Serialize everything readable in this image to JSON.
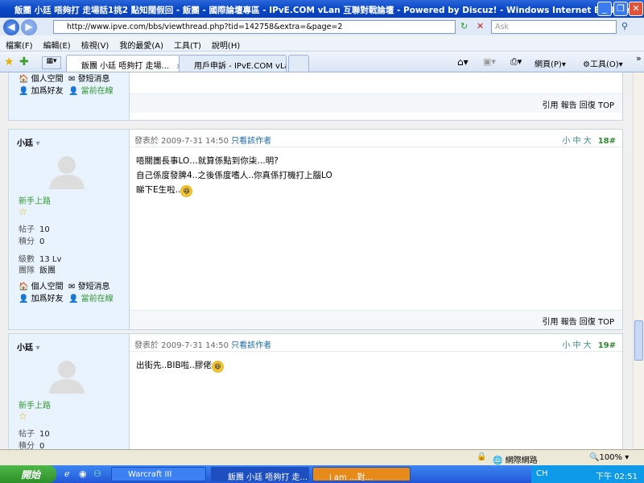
{
  "window": {
    "title": "飯團 小廷 唔夠打 走場話1挑2 點知闊假回 - 飯團 - 國際論壇專區 - IPvE.COM vLan 互聯對戰論壇 - Powered by Discuz! - Windows Internet Explorer"
  },
  "address": {
    "url": "http://www.ipve.com/bbs/viewthread.php?tid=142758&extra=&page=2",
    "search_placeholder": "Ask"
  },
  "menu": [
    "檔案(F)",
    "編輯(E)",
    "檢視(V)",
    "我的最愛(A)",
    "工具(T)",
    "說明(H)"
  ],
  "tabs": [
    {
      "label": "飯團 小廷 唔夠打 走場...",
      "close": "x"
    },
    {
      "label": "用戶申訴 - IPvE.COM vLan ..."
    }
  ],
  "toolbar": {
    "page": "網頁(P)",
    "tools": "工具(O)",
    "more": "»"
  },
  "post_prev": {
    "links": [
      "個人空間",
      "發短消息",
      "加爲好友",
      "當前在線"
    ],
    "actions": "引用 報告 回復 TOP"
  },
  "post18": {
    "user": "小廷",
    "rank": "新手上路",
    "posts_label": "帖子",
    "posts": "10",
    "score_label": "積分",
    "score": "0",
    "level_label": "級數",
    "level": "13 Lv",
    "team_label": "團隊",
    "team": "飯團",
    "links": [
      "個人空間",
      "發短消息",
      "加爲好友",
      "當前在線"
    ],
    "posted": "發表於 2009-7-31 14:50",
    "author_only": "只看該作者",
    "sizes": [
      "小",
      "中",
      "大"
    ],
    "floor": "18#",
    "lines": [
      "唔關團長事LO…就算係點到你柒…明?",
      "自己係度發脾4..之後係度嗜人..你真係打機打上腦LO",
      "睇下E生啦.."
    ],
    "actions": "引用 報告 回復 TOP"
  },
  "post19": {
    "user": "小廷",
    "rank": "新手上路",
    "posts_label": "帖子",
    "posts": "10",
    "score_label": "積分",
    "score": "0",
    "posted": "發表於 2009-7-31 14:50",
    "author_only": "只看該作者",
    "sizes": [
      "小",
      "中",
      "大"
    ],
    "floor": "19#",
    "lines": [
      "出街先..BIB啦..膠佬"
    ]
  },
  "status": {
    "zone": "網際網路",
    "zoom": "100%"
  },
  "taskbar": {
    "start": "開始",
    "tasks": [
      "Warcraft III",
      "飯團 小廷 唔夠打 走...",
      "i  am  ...對..."
    ],
    "lang": "CH",
    "clock": "下午 02:51"
  }
}
